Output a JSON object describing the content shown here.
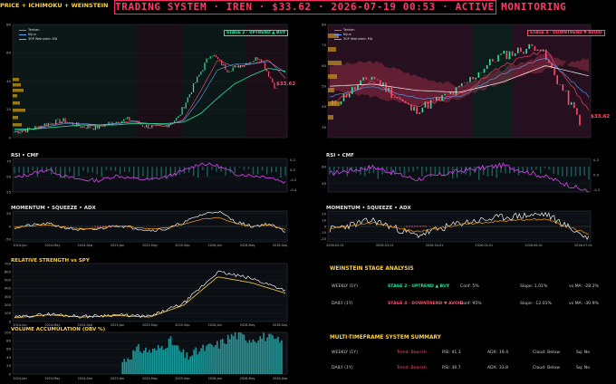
{
  "header": {
    "left_title": "PRICE + ICHIMOKU + WEINSTEIN",
    "title": "TRADING SYSTEM  ·  IREN  ·  $33.62  ·  2026-07-19 00:53  ·  ACTIVE MONITORING"
  },
  "colors": {
    "bg": "#000000",
    "panel": "#0b0f14",
    "accent": "#ff2e63",
    "gold": "#ffd23f",
    "green": "#2ee59d",
    "red": "#ff4d6d",
    "cyan": "#22d3ee"
  },
  "panels": {
    "rsi_left": "RSI • CMF",
    "mom_left": "MOMENTUM • SQUEEZE • ADX",
    "rs_left": "RELATIVE STRENGTH vs SPY",
    "vol_left": "VOLUME ACCUMULATION (OBV %)",
    "rsi_right": "RSI • CMF",
    "mom_right": "MOMENTUM • SQUEEZE • ADX"
  },
  "legend": [
    "Tenkan",
    "Kijun",
    "30P Weinstein MA"
  ],
  "badges": {
    "weekly": "STAGE 2 · UPTREND ▲ BUY",
    "daily": "STAGE 4 · DOWNTREND ▼ AVOID"
  },
  "price_label_left": "$33.62",
  "price_label_right": "$33.62",
  "weinstein": {
    "title": "WEINSTEIN STAGE ANALYSIS",
    "rows": [
      {
        "tf": "WEEKLY (1Y)",
        "stage": "STAGE 2 · UPTREND ▲ BUY",
        "conf": "Conf: 5%",
        "slope": "Slope: 1.01%",
        "vsma": "vs MA: -28.2%",
        "cls": "green"
      },
      {
        "tf": "DAILY (1Y)",
        "stage": "STAGE 4 · DOWNTREND ▼ AVOID",
        "conf": "Conf: 95%",
        "slope": "Slope: -12.01%",
        "vsma": "vs MA: -30.9%",
        "cls": "red"
      }
    ]
  },
  "mtf": {
    "title": "MULTI-TIMEFRAME SYSTEM SUMMARY",
    "rows": [
      {
        "tf": "WEEKLY (1Y)",
        "trend": "Trend: Bearish",
        "rsi": "RSI: 41.3",
        "adx": "ADX: 19.4",
        "cloud": "Cloud: Below",
        "sq": "Sq: No"
      },
      {
        "tf": "DAILY (1Y)",
        "trend": "Trend: Bearish",
        "rsi": "RSI: 30.7",
        "adx": "ADX: 33.8",
        "cloud": "Cloud: Below",
        "sq": "Sq: No"
      }
    ]
  },
  "chart_data": [
    {
      "type": "line",
      "name": "weekly_price",
      "ylim": [
        0,
        80
      ],
      "yticks": [
        "80",
        "60",
        "40",
        "20",
        "0"
      ],
      "x": [
        "2023-11",
        "2024-01",
        "2024-03",
        "2024-05",
        "2024-07",
        "2024-09",
        "2024-11",
        "2025-01",
        "2025-03",
        "2025-05",
        "2025-07",
        "2025-09",
        "2025-11",
        "2026-01",
        "2026-03",
        "2026-05",
        "2026-07"
      ],
      "series": [
        {
          "name": "Close",
          "values": [
            4,
            6,
            10,
            12,
            8,
            7,
            11,
            13,
            8,
            7,
            14,
            38,
            60,
            48,
            52,
            57,
            34
          ]
        },
        {
          "name": "Tenkan",
          "values": [
            4,
            6,
            9,
            11,
            9,
            8,
            10,
            12,
            9,
            8,
            13,
            33,
            55,
            50,
            52,
            55,
            42
          ]
        },
        {
          "name": "Kijun",
          "values": [
            5,
            6,
            8,
            10,
            10,
            9,
            10,
            11,
            10,
            9,
            12,
            28,
            48,
            52,
            52,
            54,
            46
          ]
        },
        {
          "name": "30P Weinstein MA",
          "values": [
            6,
            6,
            7,
            8,
            9,
            9,
            9,
            10,
            10,
            10,
            11,
            17,
            28,
            38,
            44,
            49,
            47
          ]
        }
      ]
    },
    {
      "type": "line",
      "name": "daily_price",
      "ylim": [
        25,
        80
      ],
      "yticks": [
        "80",
        "70",
        "60",
        "50",
        "40",
        "30"
      ],
      "x": [
        "2026-01",
        "2026-02",
        "2026-03",
        "2026-04",
        "2026-05",
        "2026-06",
        "2026-07"
      ],
      "series": [
        {
          "name": "Close",
          "values": [
            40,
            55,
            38,
            47,
            64,
            70,
            33
          ]
        },
        {
          "name": "Tenkan",
          "values": [
            42,
            52,
            40,
            46,
            60,
            68,
            38
          ]
        },
        {
          "name": "Kijun",
          "values": [
            45,
            50,
            44,
            45,
            56,
            64,
            45
          ]
        },
        {
          "name": "30P Weinstein MA",
          "values": [
            50,
            51,
            48,
            47,
            52,
            60,
            55
          ]
        }
      ]
    },
    {
      "type": "line",
      "name": "rsi_weekly",
      "ylim": [
        25,
        80
      ],
      "yticks": [
        "75",
        "50",
        "25"
      ],
      "y2ticks": [
        "0.2",
        "0.0",
        "-0.2",
        "-0.4"
      ],
      "values": [
        48,
        55,
        62,
        50,
        45,
        44,
        52,
        47,
        45,
        50,
        60,
        72,
        68,
        55,
        52,
        50,
        41
      ]
    },
    {
      "type": "line",
      "name": "rsi_daily",
      "ylim": [
        30,
        70
      ],
      "yticks": [
        "60",
        "40"
      ],
      "y2ticks": [
        "0.2",
        "0.0",
        "-0.2"
      ],
      "values": [
        52,
        60,
        45,
        55,
        62,
        48,
        30
      ]
    },
    {
      "type": "line",
      "name": "momentum_weekly",
      "ylim": [
        -60,
        60
      ],
      "yticks": [
        "50",
        "0",
        "-50"
      ],
      "values": [
        -5,
        5,
        10,
        -5,
        -15,
        -10,
        5,
        -5,
        -15,
        -10,
        15,
        45,
        60,
        20,
        0,
        10,
        -20
      ]
    },
    {
      "type": "line",
      "name": "momentum_daily",
      "ylim": [
        -25,
        25
      ],
      "yticks": [
        "20",
        "10",
        "0",
        "-10",
        "-20"
      ],
      "values": [
        -5,
        10,
        -15,
        5,
        15,
        20,
        -20
      ]
    },
    {
      "type": "line",
      "name": "relative_strength",
      "ylim": [
        0,
        700
      ],
      "yticks": [
        "700",
        "600",
        "500",
        "400",
        "300",
        "200",
        "100",
        "0"
      ],
      "x": [
        "2024-Jan",
        "2024-May",
        "2024-Sep",
        "2025-Jan",
        "2025-May",
        "2025-Sep",
        "2026-Jan",
        "2026-May",
        "2026-Sep"
      ],
      "values": [
        50,
        90,
        60,
        80,
        60,
        220,
        600,
        520,
        380
      ]
    },
    {
      "type": "bar",
      "name": "obv_pct",
      "ylim": [
        0,
        100
      ],
      "yticks": [
        "100",
        "80",
        "60",
        "40",
        "20",
        "0"
      ],
      "values": [
        30,
        60,
        55,
        80,
        40,
        60,
        70,
        95,
        85,
        90,
        75
      ]
    }
  ],
  "axes": {
    "weekly_x": [
      "2024-Jan",
      "2024-May",
      "2024-Sep",
      "2025-Jan",
      "2025-May",
      "2025-Sep",
      "2026-Jan",
      "2026-May",
      "2026-Sep"
    ],
    "daily_x": [
      "2026-02-01",
      "2026-03-01",
      "2026-04-01",
      "2026-05-01",
      "2026-06-01",
      "2026-07-01"
    ]
  }
}
